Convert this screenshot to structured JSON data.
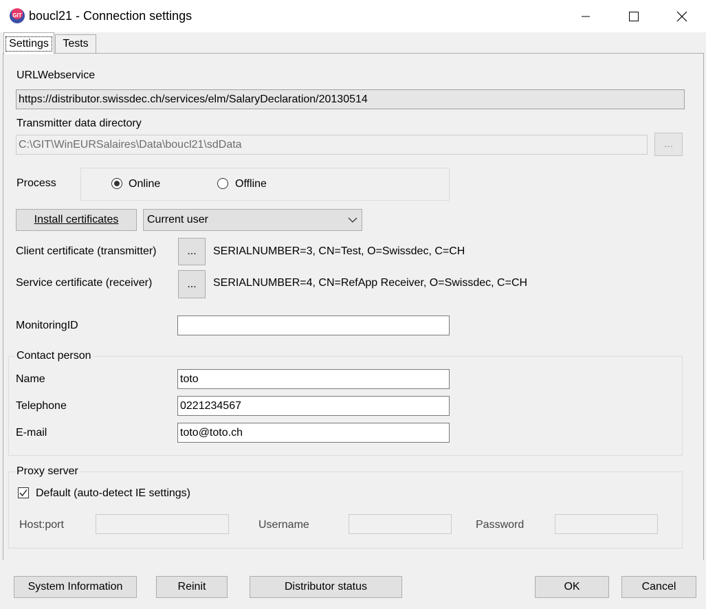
{
  "window": {
    "title": "boucl21 - Connection settings",
    "icon_text": "GIT"
  },
  "tabs": [
    {
      "label": "Settings"
    },
    {
      "label": "Tests"
    }
  ],
  "url": {
    "label": "URLWebservice",
    "value": "https://distributor.swissdec.ch/services/elm/SalaryDeclaration/20130514"
  },
  "transmitter": {
    "label": "Transmitter data directory",
    "value": "C:\\GIT\\WinEURSalaires\\Data\\boucl21\\sdData",
    "browse_label": "..."
  },
  "process": {
    "label": "Process",
    "options": [
      "Online",
      "Offline"
    ],
    "selected": "Online"
  },
  "certs": {
    "install_label": "Install certificates",
    "store_selected": "Current user",
    "client_label": "Client certificate (transmitter)",
    "client_btn": "...",
    "client_value": "SERIALNUMBER=3, CN=Test, O=Swissdec, C=CH",
    "service_label": "Service certificate (receiver)",
    "service_btn": "...",
    "service_value": "SERIALNUMBER=4, CN=RefApp Receiver, O=Swissdec, C=CH"
  },
  "monitoring": {
    "label": "MonitoringID",
    "value": ""
  },
  "contact": {
    "legend": "Contact person",
    "name_label": "Name",
    "name_value": "toto",
    "phone_label": "Telephone",
    "phone_value": "0221234567",
    "email_label": "E-mail",
    "email_value": "toto@toto.ch"
  },
  "proxy": {
    "legend": "Proxy server",
    "default_label": "Default (auto-detect IE settings)",
    "default_checked": true,
    "host_label": "Host:port",
    "host_value": "",
    "user_label": "Username",
    "user_value": "",
    "pass_label": "Password",
    "pass_value": ""
  },
  "buttons": {
    "sysinfo": "System Information",
    "reinit": "Reinit",
    "distributor": "Distributor status",
    "ok": "OK",
    "cancel": "Cancel"
  }
}
